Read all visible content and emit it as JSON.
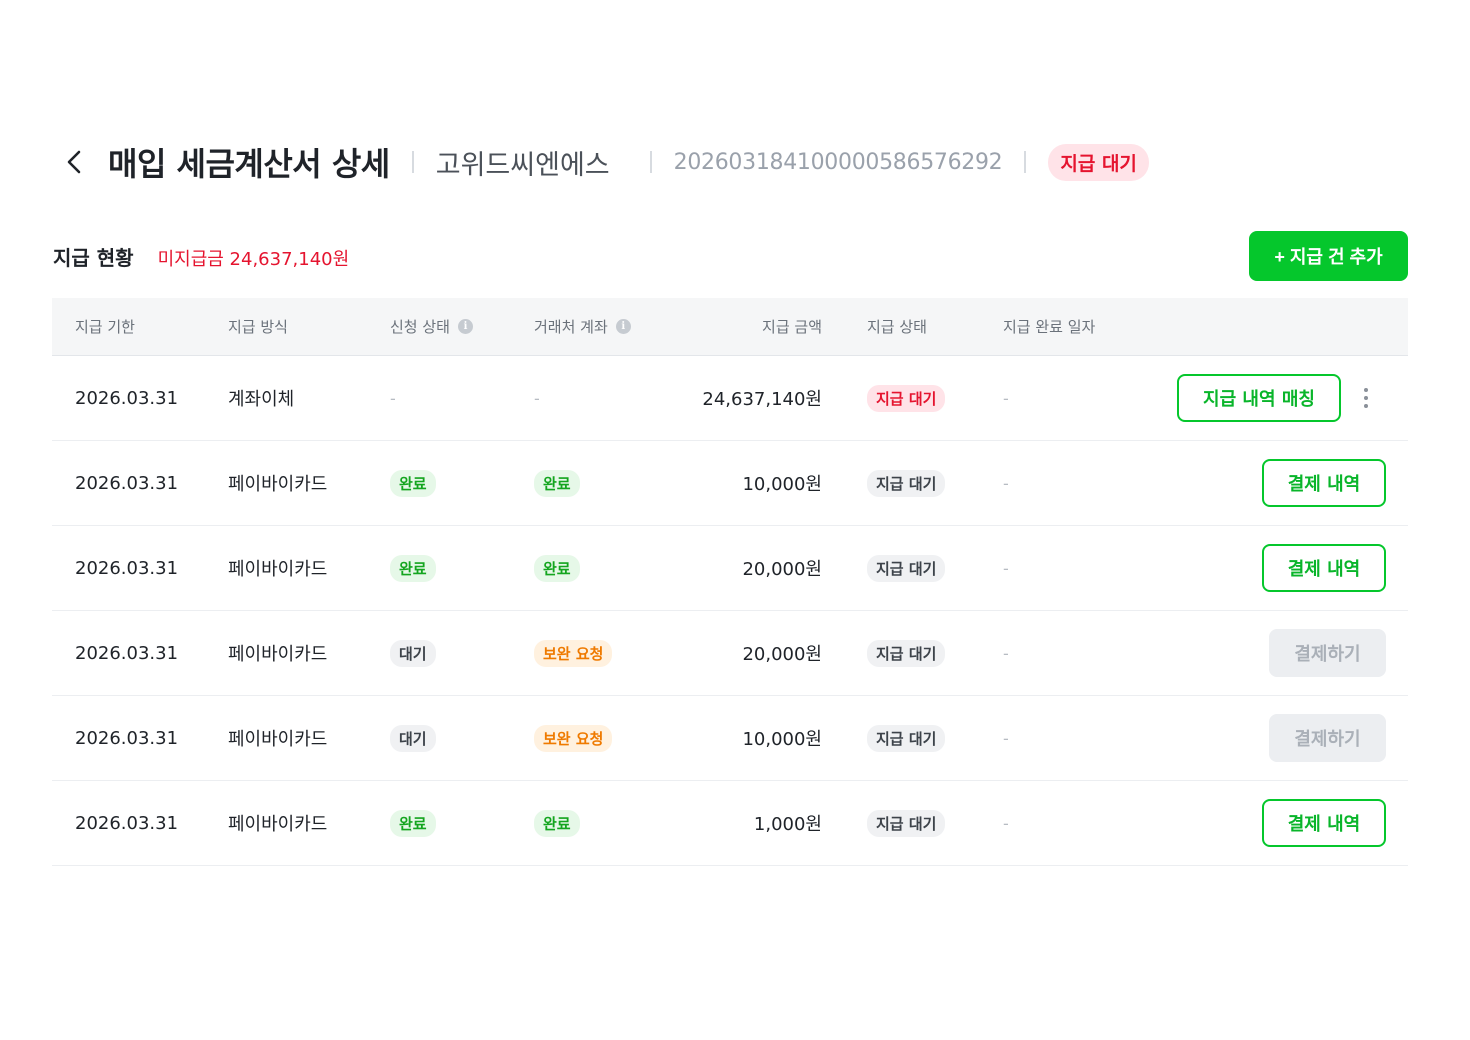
{
  "header": {
    "title": "매입 세금계산서 상세",
    "vendor": "고위드씨엔에스",
    "document_number": "20260318410000058657629​2",
    "status_badge": "지급 대기"
  },
  "summary": {
    "title": "지급 현황",
    "unpaid": "미지급금 24,637,140원",
    "add_button": "+ 지급 건 추가"
  },
  "table": {
    "columns": [
      "지급 기한",
      "지급 방식",
      "신청 상태",
      "거래처 계좌",
      "지급 금액",
      "지급 상태",
      "지급 완료 일자"
    ],
    "rows": [
      {
        "due": "2026.03.31",
        "method": "계좌이체",
        "request": "-",
        "account": "-",
        "amount": "24,637,140원",
        "status": "지급 대기",
        "done": "-",
        "action": "지급 내역 매칭"
      },
      {
        "due": "2026.03.31",
        "method": "페이바이카드",
        "request": "완료",
        "account": "완료",
        "amount": "10,000원",
        "status": "지급 대기",
        "done": "-",
        "action": "결제 내역"
      },
      {
        "due": "2026.03.31",
        "method": "페이바이카드",
        "request": "완료",
        "account": "완료",
        "amount": "20,000원",
        "status": "지급 대기",
        "done": "-",
        "action": "결제 내역"
      },
      {
        "due": "2026.03.31",
        "method": "페이바이카드",
        "request": "대기",
        "account": "보완 요청",
        "amount": "20,000원",
        "status": "지급 대기",
        "done": "-",
        "action": "결제하기"
      },
      {
        "due": "2026.03.31",
        "method": "페이바이카드",
        "request": "대기",
        "account": "보완 요청",
        "amount": "10,000원",
        "status": "지급 대기",
        "done": "-",
        "action": "결제하기"
      },
      {
        "due": "2026.03.31",
        "method": "페이바이카드",
        "request": "완료",
        "account": "완료",
        "amount": "1,000원",
        "status": "지급 대기",
        "done": "-",
        "action": "결제 내역"
      }
    ]
  },
  "icons": {
    "back": "chevron-left-icon",
    "info": "info-icon",
    "more": "more-vertical-icon"
  },
  "colors": {
    "brand_green": "#05c72c",
    "alert_red": "#e5142f",
    "warn_orange": "#ef7a00"
  }
}
